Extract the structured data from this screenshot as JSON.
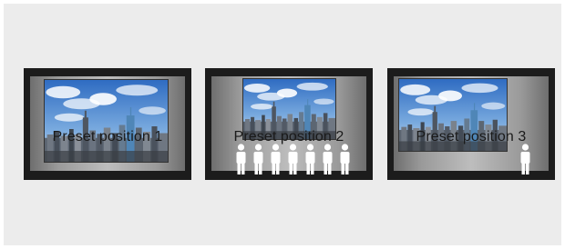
{
  "presets": [
    {
      "label": "Preset position 1"
    },
    {
      "label": "Preset position 2"
    },
    {
      "label": "Preset position 3"
    }
  ],
  "colors": {
    "background": "#ececec",
    "frame": "#1c1c1c",
    "sky": "#3d78c7",
    "person": "#ffffff"
  }
}
